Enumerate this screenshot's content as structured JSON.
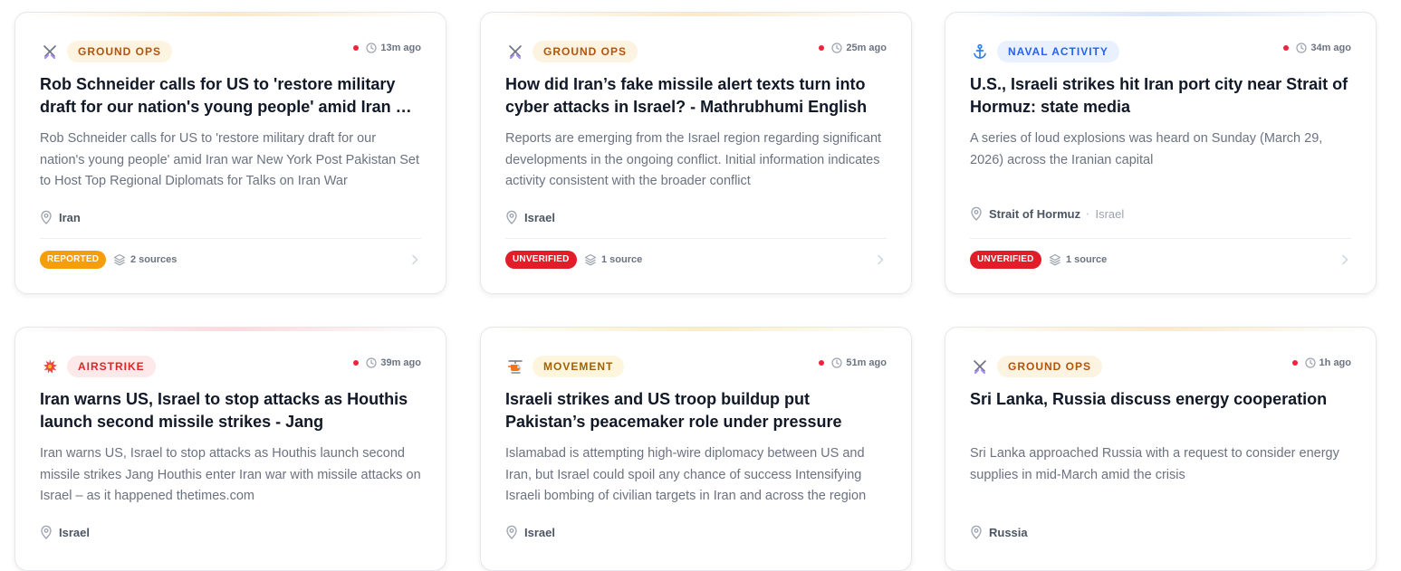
{
  "colors": {
    "ground_ops_bg": "#fdf3e1",
    "ground_ops_text": "#b45309",
    "naval_bg": "#e8f1fd",
    "naval_text": "#2563eb",
    "airstrike_bg": "#fde8ea",
    "airstrike_text": "#dc2626",
    "movement_bg": "#fdf5dc",
    "movement_text": "#a16207",
    "reported": "#f59e0b",
    "unverified": "#e11d2a",
    "live_dot": "#ef233c"
  },
  "cards": [
    {
      "category": "GROUND OPS",
      "category_icon": "crossed-swords-icon",
      "time": "13m ago",
      "title": "Rob Schneider calls for US to 'restore military draft for our nation's young people' amid Iran war - New York Post",
      "description": "Rob Schneider calls for US to 'restore military draft for our nation's young people' amid Iran war New York Post Pakistan Set to Host Top Regional Diplomats for Talks on Iran War",
      "location": "Iran",
      "location_secondary": "",
      "status": "REPORTED",
      "sources": "2 sources"
    },
    {
      "category": "GROUND OPS",
      "category_icon": "crossed-swords-icon",
      "time": "25m ago",
      "title": "How did Iran’s fake missile alert texts turn into cyber attacks in Israel? - Mathrubhumi English",
      "description": "Reports are emerging from the Israel region regarding significant developments in the ongoing conflict. Initial information indicates activity consistent with the broader conflict",
      "location": "Israel",
      "location_secondary": "",
      "status": "UNVERIFIED",
      "sources": "1 source"
    },
    {
      "category": "NAVAL ACTIVITY",
      "category_icon": "anchor-icon",
      "time": "34m ago",
      "title": "U.S., Israeli strikes hit Iran port city near Strait of Hormuz: state media",
      "description": "A series of loud explosions was heard on Sunday (March 29, 2026) across the Iranian capital",
      "location": "Strait of Hormuz",
      "location_secondary": "Israel",
      "status": "UNVERIFIED",
      "sources": "1 source"
    },
    {
      "category": "AIRSTRIKE",
      "category_icon": "explosion-icon",
      "time": "39m ago",
      "title": "Iran warns US, Israel to stop attacks as Houthis launch second missile strikes - Jang",
      "description": "Iran warns US, Israel to stop attacks as Houthis launch second missile strikes Jang Houthis enter Iran war with missile attacks on Israel – as it happened thetimes.com",
      "location": "Israel",
      "location_secondary": ""
    },
    {
      "category": "MOVEMENT",
      "category_icon": "helicopter-icon",
      "time": "51m ago",
      "title": "Israeli strikes and US troop buildup put Pakistan’s peacemaker role under pressure",
      "description": "Islamabad is attempting high-wire diplomacy between US and Iran, but Israel could spoil any chance of success Intensifying Israeli bombing of civilian targets in Iran and across the region",
      "location": "Israel",
      "location_secondary": ""
    },
    {
      "category": "GROUND OPS",
      "category_icon": "crossed-swords-icon",
      "time": "1h ago",
      "title": "Sri Lanka, Russia discuss energy cooperation",
      "description": "Sri Lanka approached Russia with a request to consider energy supplies in mid-March amid the crisis",
      "location": "Russia",
      "location_secondary": ""
    }
  ]
}
